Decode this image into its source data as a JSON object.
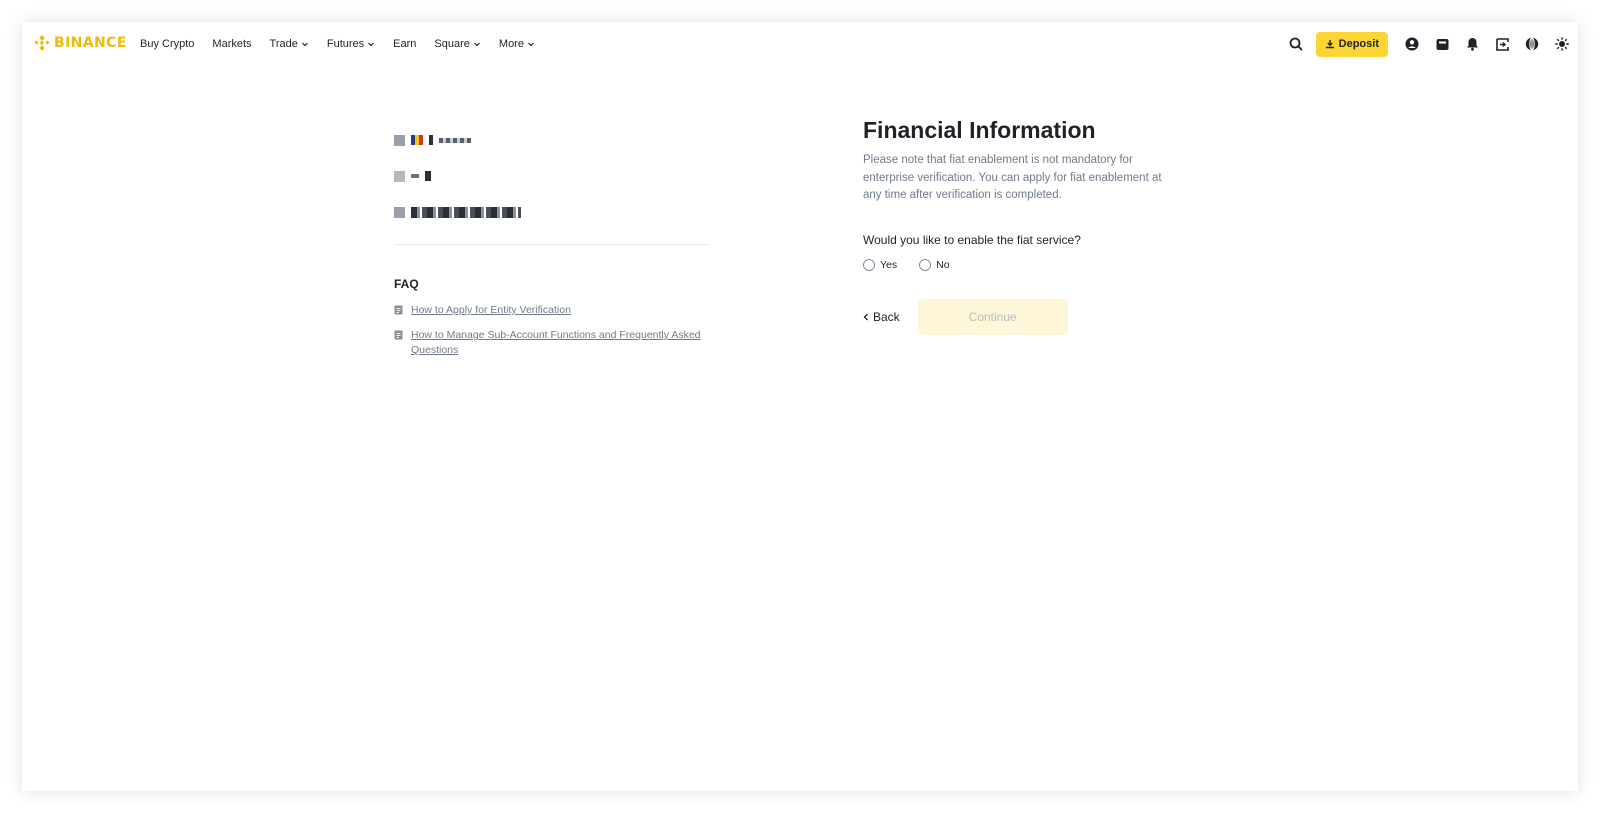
{
  "header": {
    "brand": "BINANCE",
    "nav": [
      {
        "label": "Buy Crypto",
        "dropdown": false
      },
      {
        "label": "Markets",
        "dropdown": false
      },
      {
        "label": "Trade",
        "dropdown": true
      },
      {
        "label": "Futures",
        "dropdown": true
      },
      {
        "label": "Earn",
        "dropdown": false
      },
      {
        "label": "Square",
        "dropdown": true
      },
      {
        "label": "More",
        "dropdown": true
      }
    ],
    "deposit_label": "Deposit",
    "icons": [
      "search-icon",
      "deposit-download-icon",
      "user-icon",
      "wallet-icon",
      "bell-icon",
      "download-app-icon",
      "globe-icon",
      "theme-sun-icon"
    ]
  },
  "sidebar": {
    "faq_title": "FAQ",
    "faq_items": [
      "How to Apply for Entity Verification",
      "How to Manage Sub-Account Functions and Frequently Asked Questions"
    ]
  },
  "main": {
    "title": "Financial Information",
    "description": "Please note that fiat enablement is not mandatory for enterprise verification. You can apply for fiat enablement at any time after verification is completed.",
    "question": "Would you like to enable the fiat service?",
    "options": [
      "Yes",
      "No"
    ],
    "back_label": "Back",
    "continue_label": "Continue"
  },
  "colors": {
    "brand_yellow": "#f0b90b",
    "deposit_bg": "#fcd535",
    "continue_disabled_bg": "#fef6d8",
    "muted_text": "#707a8a"
  }
}
